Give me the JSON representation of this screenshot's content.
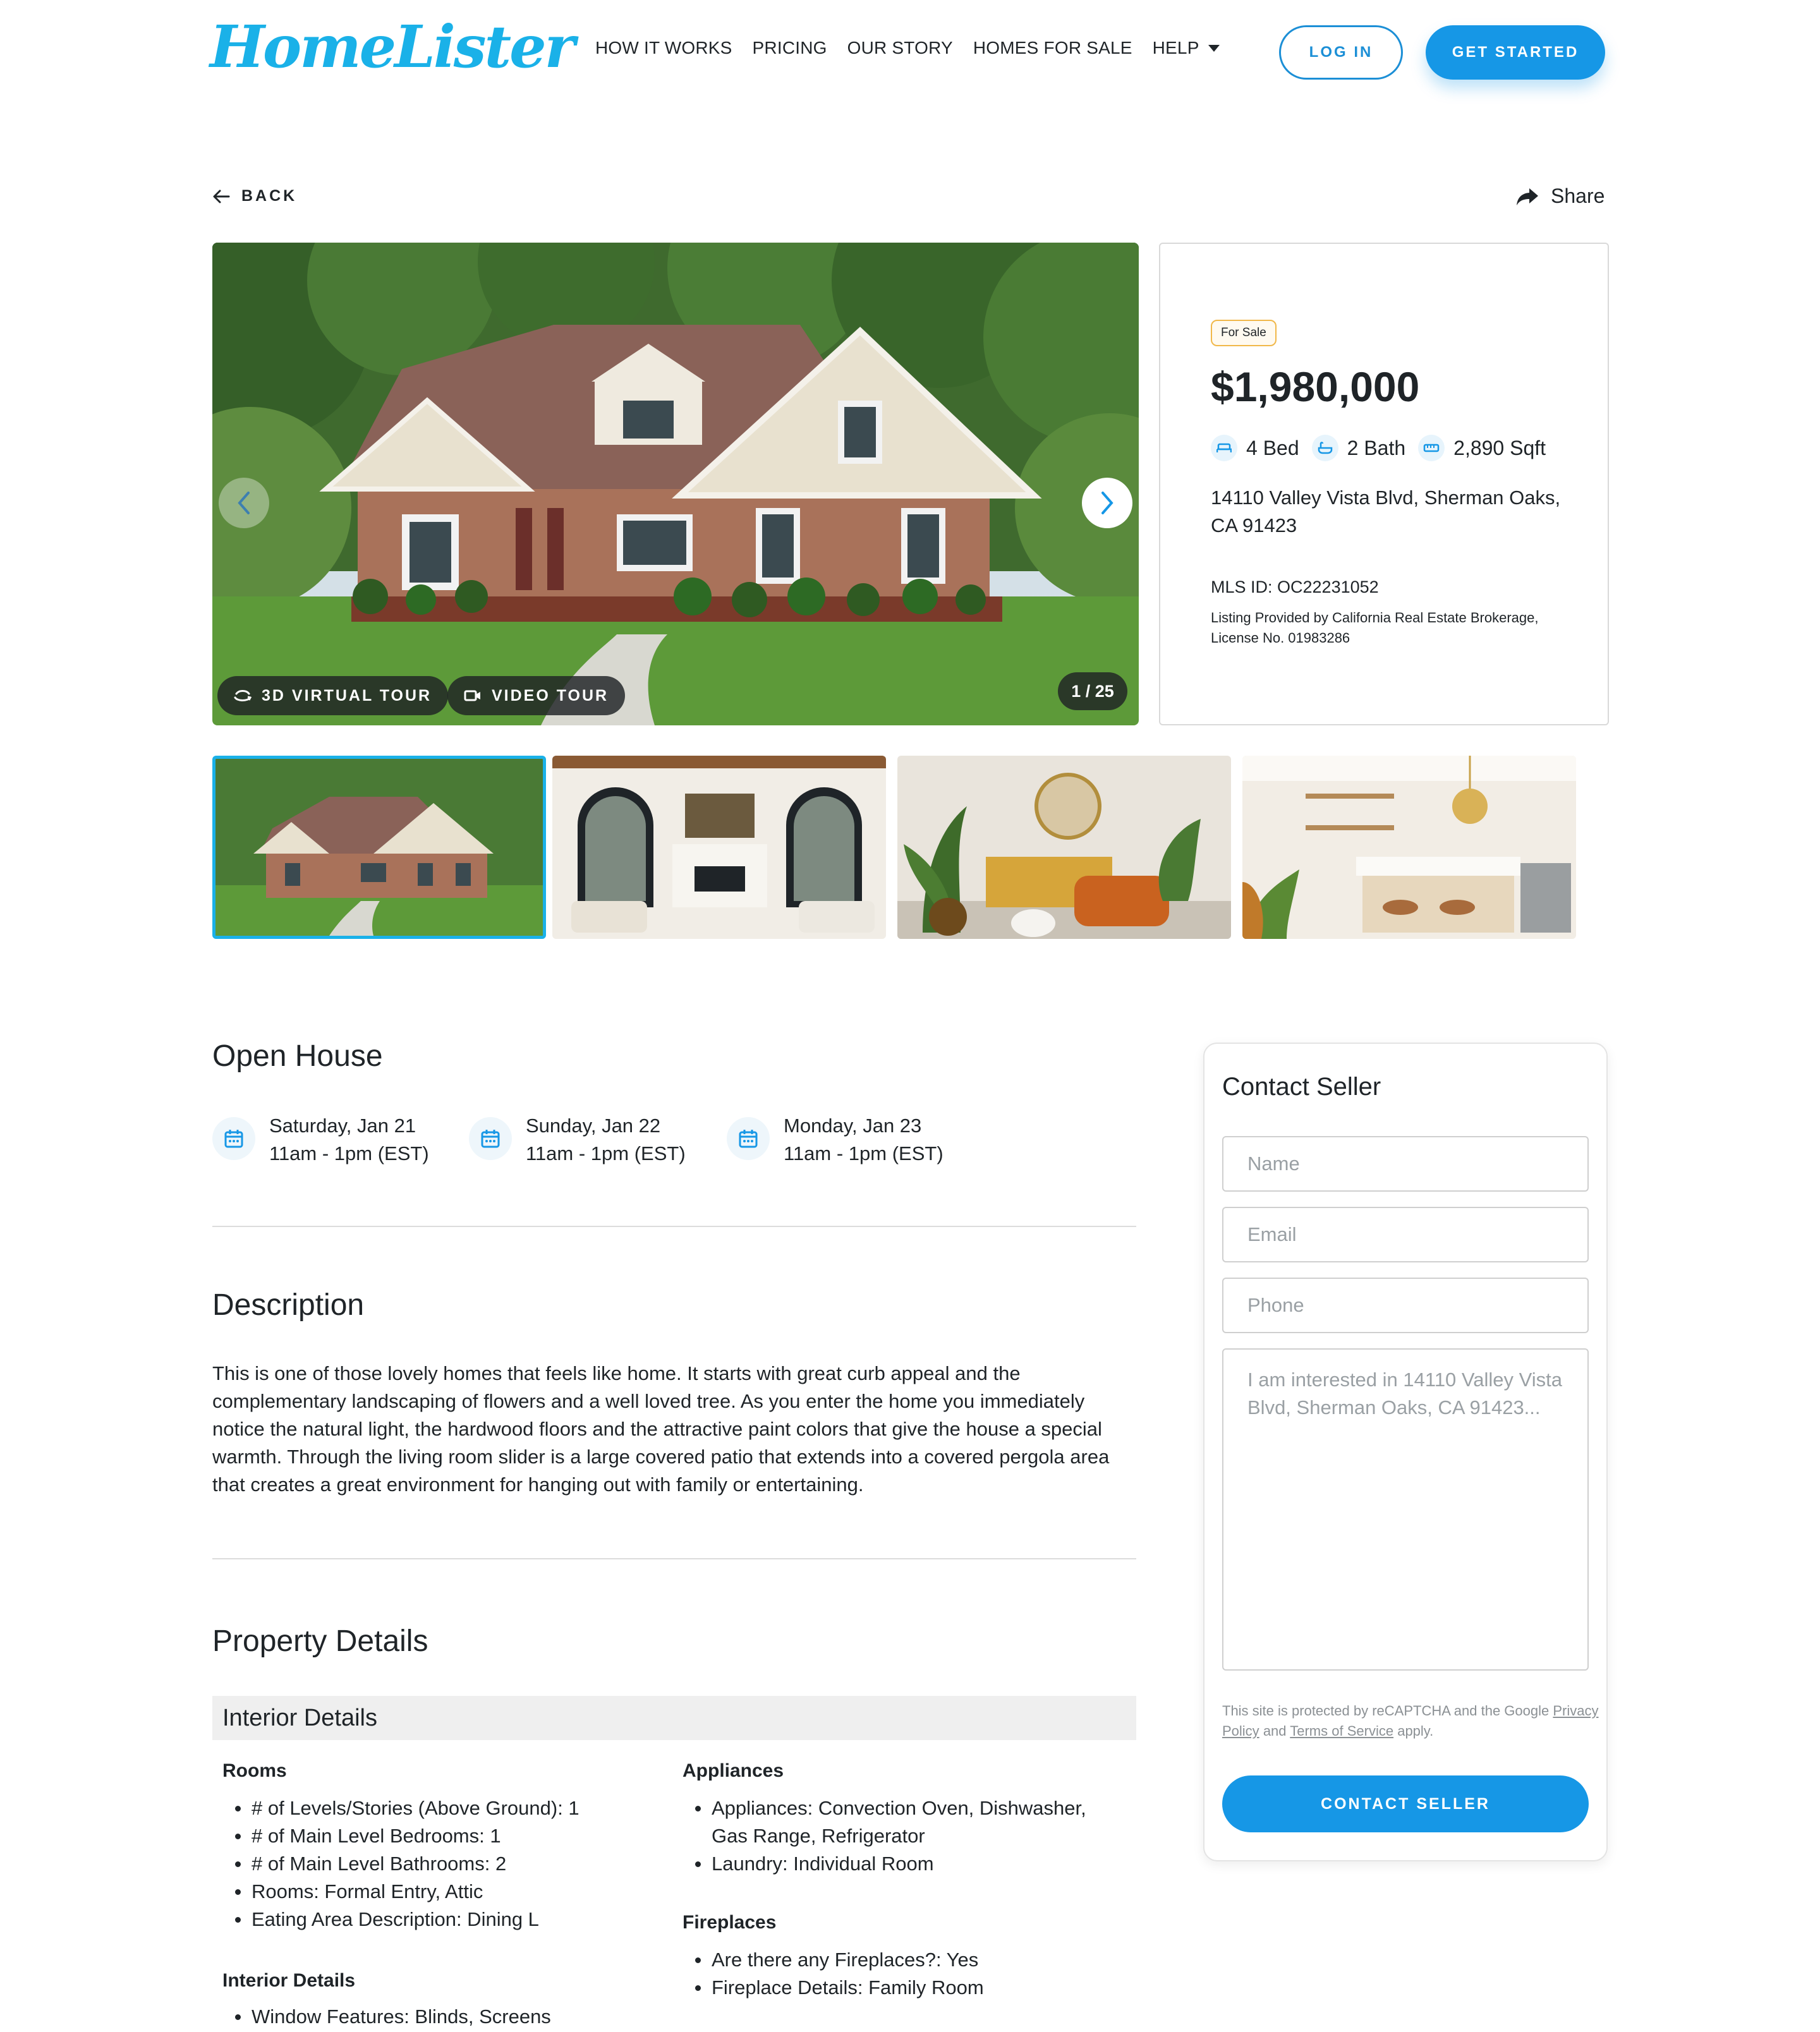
{
  "header": {
    "logo": "HomeLister",
    "nav": [
      "HOW IT WORKS",
      "PRICING",
      "OUR STORY",
      "HOMES FOR SALE",
      "HELP"
    ],
    "login": "LOG IN",
    "get_started": "GET STARTED"
  },
  "back": "BACK",
  "share": "Share",
  "gallery": {
    "virtual_tour": "3D VIRTUAL TOUR",
    "video_tour": "VIDEO TOUR",
    "counter": "1 / 25"
  },
  "listing": {
    "status": "For Sale",
    "price": "$1,980,000",
    "beds": "4 Bed",
    "baths": "2 Bath",
    "sqft": "2,890 Sqft",
    "address": "14110 Valley Vista Blvd, Sherman Oaks, CA 91423",
    "mls": "MLS ID: OC22231052",
    "provider": "Listing Provided by California Real Estate Brokerage, License No. 01983286"
  },
  "open_house": {
    "title": "Open House",
    "dates": [
      {
        "day": "Saturday, Jan 21",
        "time": "11am - 1pm (EST)"
      },
      {
        "day": "Sunday, Jan 22",
        "time": "11am - 1pm (EST)"
      },
      {
        "day": "Monday, Jan 23",
        "time": "11am - 1pm (EST)"
      }
    ]
  },
  "description": {
    "title": "Description",
    "text": "This is one of those lovely homes that feels like home. It starts with great curb appeal and the complementary landscaping of flowers and a well loved tree. As you enter the home you immediately notice the natural light, the hardwood floors and the attractive paint colors that give the house a special warmth. Through the living room slider is a large covered patio that extends into a covered pergola area that creates a great environment for hanging out with family or entertaining."
  },
  "property": {
    "title": "Property Details",
    "interior_title": "Interior Details",
    "rooms_title": "Rooms",
    "rooms": [
      "# of Levels/Stories (Above Ground): 1",
      "# of Main Level Bedrooms: 1",
      "# of Main Level Bathrooms: 2",
      "Rooms: Formal Entry, Attic",
      "Eating Area Description: Dining L"
    ],
    "appliances_title": "Appliances",
    "appliances": [
      "Appliances: Convection Oven, Dishwasher, Gas Range, Refrigerator",
      "Laundry: Individual Room"
    ],
    "fireplaces_title": "Fireplaces",
    "fireplaces": [
      "Are there any Fireplaces?: Yes",
      "Fireplace Details: Family Room"
    ],
    "interior_sub_title": "Interior Details",
    "interior": [
      "Window Features: Blinds, Screens"
    ]
  },
  "contact": {
    "title": "Contact Seller",
    "name_placeholder": "Name",
    "email_placeholder": "Email",
    "phone_placeholder": "Phone",
    "message_placeholder": "I am interested in 14110 Valley Vista Blvd, Sherman Oaks, CA 91423...",
    "recaptcha_prefix": "This site is protected by reCAPTCHA and the Google",
    "privacy": "Privacy Policy",
    "and": "and",
    "terms": "Terms of Service",
    "apply": "apply.",
    "button": "CONTACT SELLER"
  },
  "colors": {
    "brand": "#1ab1e8",
    "primary_button": "#1697e6",
    "badge_border": "#f1b84a"
  },
  "icons": [
    "arrow-left-icon",
    "share-arrow-icon",
    "chevron-left-icon",
    "chevron-right-icon",
    "vr-tour-icon",
    "video-camera-icon",
    "bed-icon",
    "bath-icon",
    "ruler-icon",
    "calendar-icon",
    "caret-down-icon"
  ]
}
